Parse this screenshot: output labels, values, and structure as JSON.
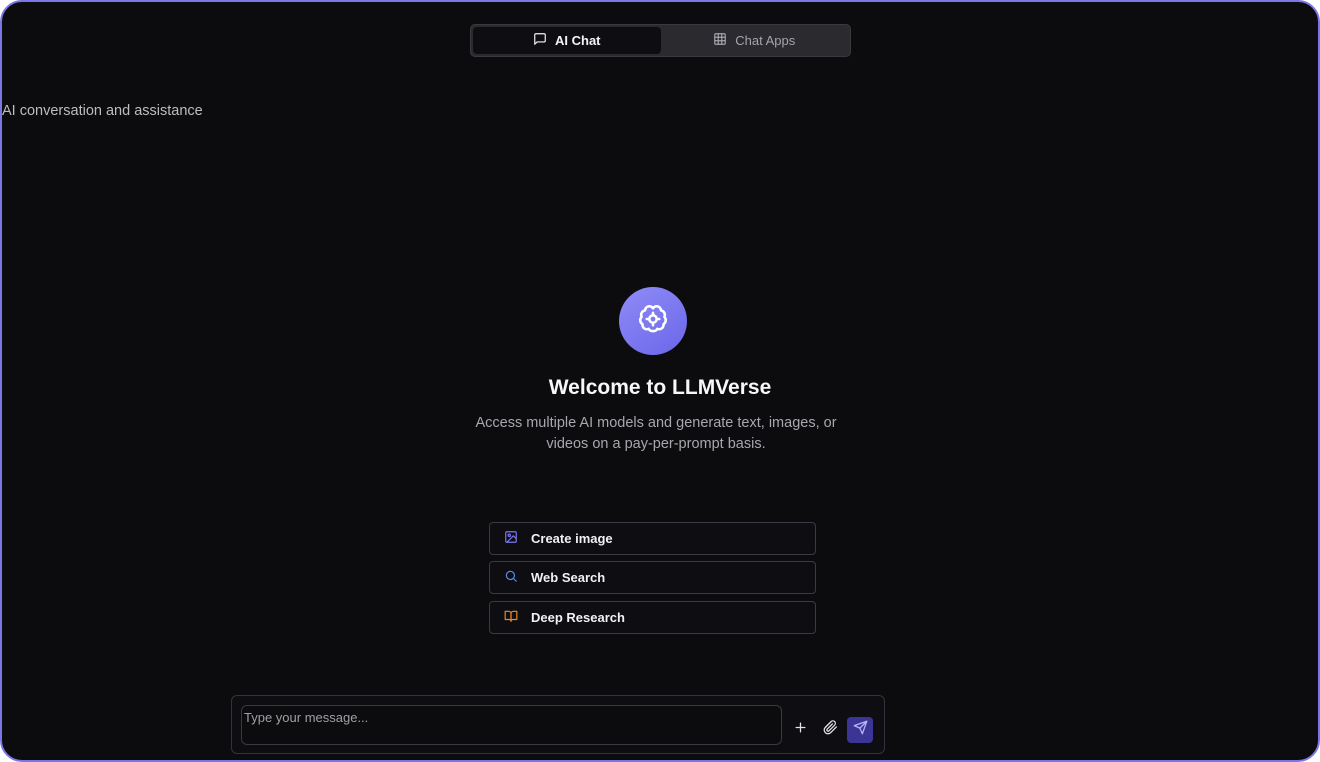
{
  "tabs": [
    {
      "label": "AI Chat",
      "icon": "chat-bubble-icon",
      "active": true
    },
    {
      "label": "Chat Apps",
      "icon": "grid-icon",
      "active": false
    }
  ],
  "header": {
    "subtitle": "AI conversation and assistance"
  },
  "welcome": {
    "logo_icon": "brain-icon",
    "title": "Welcome to LLMVerse",
    "description": "Access multiple AI models and generate text, images, or videos on a pay-per-prompt basis."
  },
  "actions": [
    {
      "label": "Create image",
      "icon": "image-icon",
      "color": "#7b78f0"
    },
    {
      "label": "Web Search",
      "icon": "search-icon",
      "color": "#5b8cf0"
    },
    {
      "label": "Deep Research",
      "icon": "book-open-icon",
      "color": "#e68a2e"
    }
  ],
  "composer": {
    "placeholder": "Type your message...",
    "value": "",
    "add_icon": "plus-icon",
    "attach_icon": "paperclip-icon",
    "send_icon": "send-icon"
  },
  "colors": {
    "accent": "#6b66ea",
    "background": "#0c0b0e",
    "send_button": "#3b3596"
  }
}
